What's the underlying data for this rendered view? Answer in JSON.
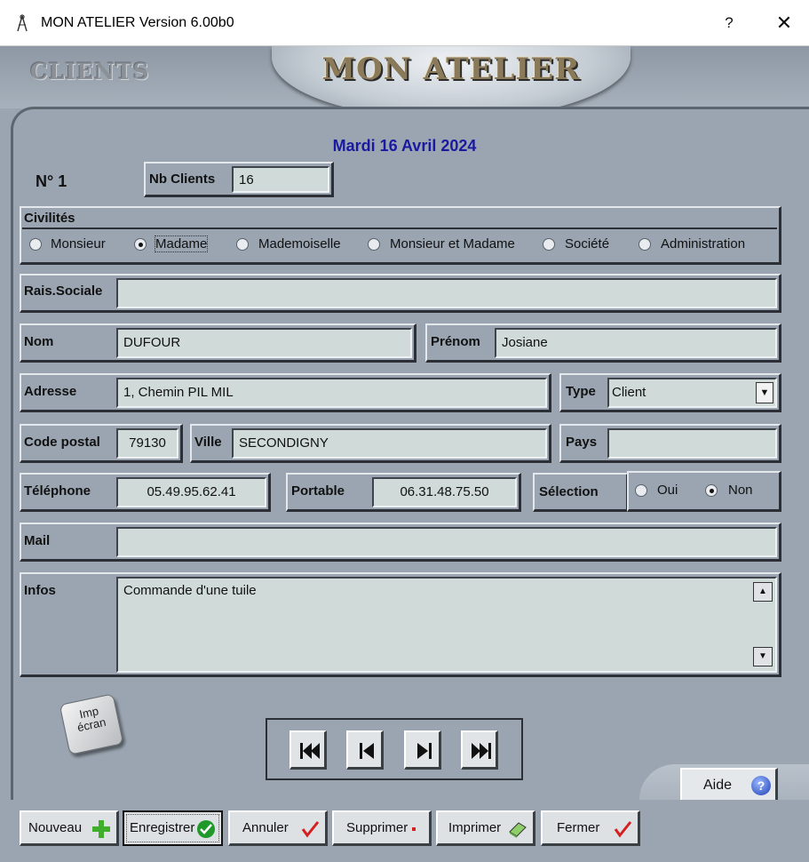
{
  "window": {
    "title": "MON ATELIER  Version 6.00b0",
    "help_label": "?",
    "close_label": "✕"
  },
  "header": {
    "section": "CLIENTS",
    "logo": "MON ATELIER",
    "date": "Mardi 16 Avril 2024"
  },
  "record": {
    "number_label": "N° 1",
    "nb_clients_label": "Nb Clients",
    "nb_clients_value": "16"
  },
  "civilites": {
    "label": "Civilités",
    "options": [
      "Monsieur",
      "Madame",
      "Mademoiselle",
      "Monsieur et Madame",
      "Société",
      "Administration"
    ],
    "selected": "Madame"
  },
  "fields": {
    "rais_sociale": {
      "label": "Rais.Sociale",
      "value": ""
    },
    "nom": {
      "label": "Nom",
      "value": "DUFOUR"
    },
    "prenom": {
      "label": "Prénom",
      "value": "Josiane"
    },
    "adresse": {
      "label": "Adresse",
      "value": "1, Chemin PIL MIL"
    },
    "type": {
      "label": "Type",
      "value": "Client"
    },
    "code_postal": {
      "label": "Code postal",
      "value": "79130"
    },
    "ville": {
      "label": "Ville",
      "value": "SECONDIGNY"
    },
    "pays": {
      "label": "Pays",
      "value": ""
    },
    "telephone": {
      "label": "Téléphone",
      "value": "05.49.95.62.41"
    },
    "portable": {
      "label": "Portable",
      "value": "06.31.48.75.50"
    },
    "mail": {
      "label": "Mail",
      "value": ""
    },
    "infos": {
      "label": "Infos",
      "value": "Commande d'une tuile"
    }
  },
  "selection": {
    "label": "Sélection",
    "options": [
      "Oui",
      "Non"
    ],
    "selected": "Non"
  },
  "print_key": {
    "line1": "Imp",
    "line2": "écran"
  },
  "navigation": [
    "first-record",
    "previous-record",
    "next-record",
    "last-record"
  ],
  "aide": {
    "label": "Aide",
    "icon": "?"
  },
  "actions": [
    {
      "label": "Nouveau",
      "icon": "plus-icon",
      "color": "#3fae2a"
    },
    {
      "label": "Enregistrer",
      "icon": "check-circle-icon",
      "color": "#1f9a2a"
    },
    {
      "label": "Annuler",
      "icon": "checkmark-icon",
      "color": "#d42020"
    },
    {
      "label": "Supprimer",
      "icon": "dot-icon",
      "color": "#d42020"
    },
    {
      "label": "Imprimer",
      "icon": "eraser-icon",
      "color": "#5aa84a"
    },
    {
      "label": "Fermer",
      "icon": "checkmark-icon",
      "color": "#d42020"
    }
  ]
}
